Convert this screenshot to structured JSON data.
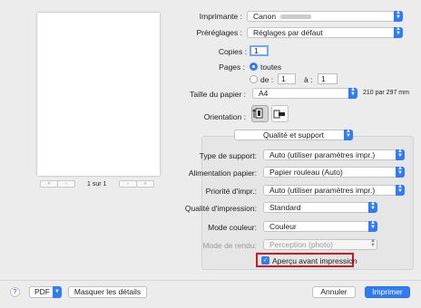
{
  "preview": {
    "page_label": "1 sur 1"
  },
  "printer": {
    "label": "Imprimante :",
    "value": "Canon"
  },
  "presets": {
    "label": "Préréglages :",
    "value": "Réglages par défaut"
  },
  "copies": {
    "label": "Copies :",
    "value": "1"
  },
  "pages": {
    "label": "Pages :",
    "option_all": "toutes",
    "option_from": "de :",
    "from_value": "1",
    "to_label": "à :",
    "to_value": "1"
  },
  "paper_size": {
    "label": "Taille du papier :",
    "value": "A4",
    "dimensions": "210 par 297 mm"
  },
  "orientation": {
    "label": "Orientation :"
  },
  "section": {
    "value": "Qualité et support"
  },
  "media_type": {
    "label": "Type de support:",
    "value": "Auto (utiliser paramètres impr.)"
  },
  "paper_source": {
    "label": "Alimentation papier:",
    "value": "Papier rouleau (Auto)"
  },
  "print_priority": {
    "label": "Priorité d'impr.:",
    "value": "Auto (utiliser paramètres impr.)"
  },
  "print_quality": {
    "label": "Qualité d'impression:",
    "value": "Standard"
  },
  "color_mode": {
    "label": "Mode couleur:",
    "value": "Couleur"
  },
  "rendering": {
    "label": "Mode de rendu:",
    "value": "Perception (photo)"
  },
  "preview_checkbox": {
    "label": "Aperçu avant impression",
    "checked": true
  },
  "footer": {
    "help": "?",
    "pdf": "PDF",
    "hide_details": "Masquer les détails",
    "cancel": "Annuler",
    "print": "Imprimer"
  },
  "colors": {
    "accent": "#2f7cf6",
    "highlight": "#d9141e"
  }
}
